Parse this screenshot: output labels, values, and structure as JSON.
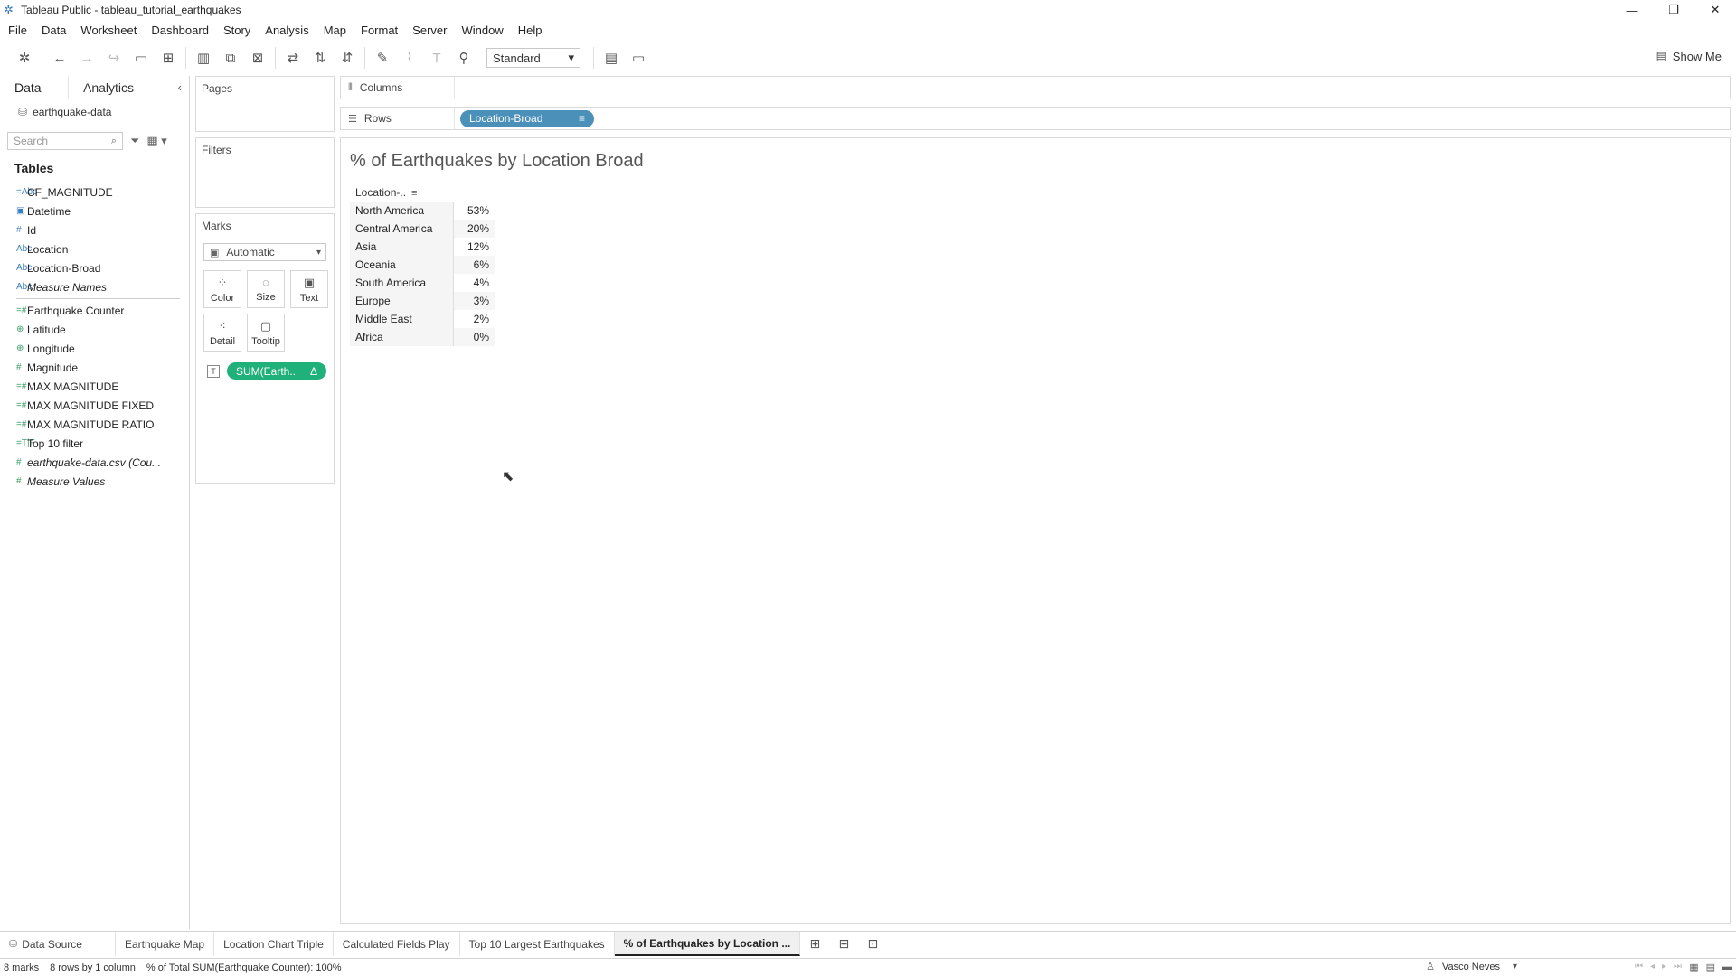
{
  "window": {
    "title": "Tableau Public - tableau_tutorial_earthquakes",
    "controls": [
      "—",
      "❐",
      "✕"
    ]
  },
  "menu": [
    "File",
    "Data",
    "Worksheet",
    "Dashboard",
    "Story",
    "Analysis",
    "Map",
    "Format",
    "Server",
    "Window",
    "Help"
  ],
  "toolbar": {
    "fit_value": "Standard",
    "show_me_label": "Show Me"
  },
  "data_pane": {
    "tab_data": "Data",
    "tab_analytics": "Analytics",
    "data_source": "earthquake-data",
    "search_placeholder": "Search",
    "tables_heading": "Tables",
    "dimensions": [
      {
        "icon": "=Abc",
        "name": "CF_MAGNITUDE"
      },
      {
        "icon": "▣",
        "name": "Datetime"
      },
      {
        "icon": "#",
        "name": "Id"
      },
      {
        "icon": "Abc",
        "name": "Location"
      },
      {
        "icon": "Abc",
        "name": "Location-Broad"
      },
      {
        "icon": "Abc",
        "name": "Measure Names"
      }
    ],
    "measures": [
      {
        "icon": "=#",
        "name": "Earthquake Counter"
      },
      {
        "icon": "⊕",
        "name": "Latitude"
      },
      {
        "icon": "⊕",
        "name": "Longitude"
      },
      {
        "icon": "#",
        "name": "Magnitude"
      },
      {
        "icon": "=#",
        "name": "MAX MAGNITUDE"
      },
      {
        "icon": "=#",
        "name": "MAX MAGNITUDE FIXED"
      },
      {
        "icon": "=#",
        "name": "MAX MAGNITUDE RATIO"
      },
      {
        "icon": "=T|F",
        "name": "Top 10 filter"
      },
      {
        "icon": "#",
        "name": "earthquake-data.csv (Cou..."
      },
      {
        "icon": "#",
        "name": "Measure Values"
      }
    ]
  },
  "cards": {
    "pages": "Pages",
    "filters": "Filters",
    "marks": "Marks",
    "mark_type": "Automatic",
    "mark_buttons": [
      "Color",
      "Size",
      "Text",
      "Detail",
      "Tooltip"
    ],
    "mark_pill": "SUM(Earth..",
    "mark_pill_delta": "Δ"
  },
  "shelves": {
    "columns_label": "Columns",
    "rows_label": "Rows",
    "rows_pill": "Location-Broad"
  },
  "view": {
    "title": "% of Earthquakes by Location Broad",
    "header": "Location-..",
    "rows": [
      {
        "cat": "North America",
        "val": "53%"
      },
      {
        "cat": "Central America",
        "val": "20%"
      },
      {
        "cat": "Asia",
        "val": "12%"
      },
      {
        "cat": "Oceania",
        "val": "6%"
      },
      {
        "cat": "South America",
        "val": "4%"
      },
      {
        "cat": "Europe",
        "val": "3%"
      },
      {
        "cat": "Middle East",
        "val": "2%"
      },
      {
        "cat": "Africa",
        "val": "0%"
      }
    ]
  },
  "sheet_tabs": {
    "data_source": "Data Source",
    "sheets": [
      "Earthquake Map",
      "Location Chart Triple",
      "Calculated Fields Play",
      "Top 10 Largest Earthquakes",
      "% of Earthquakes by Location ..."
    ],
    "active_index": 4
  },
  "status": {
    "marks": "8 marks",
    "rows_cols": "8 rows by 1 column",
    "total": "% of Total SUM(Earthquake Counter): 100%",
    "user": "Vasco Neves"
  }
}
